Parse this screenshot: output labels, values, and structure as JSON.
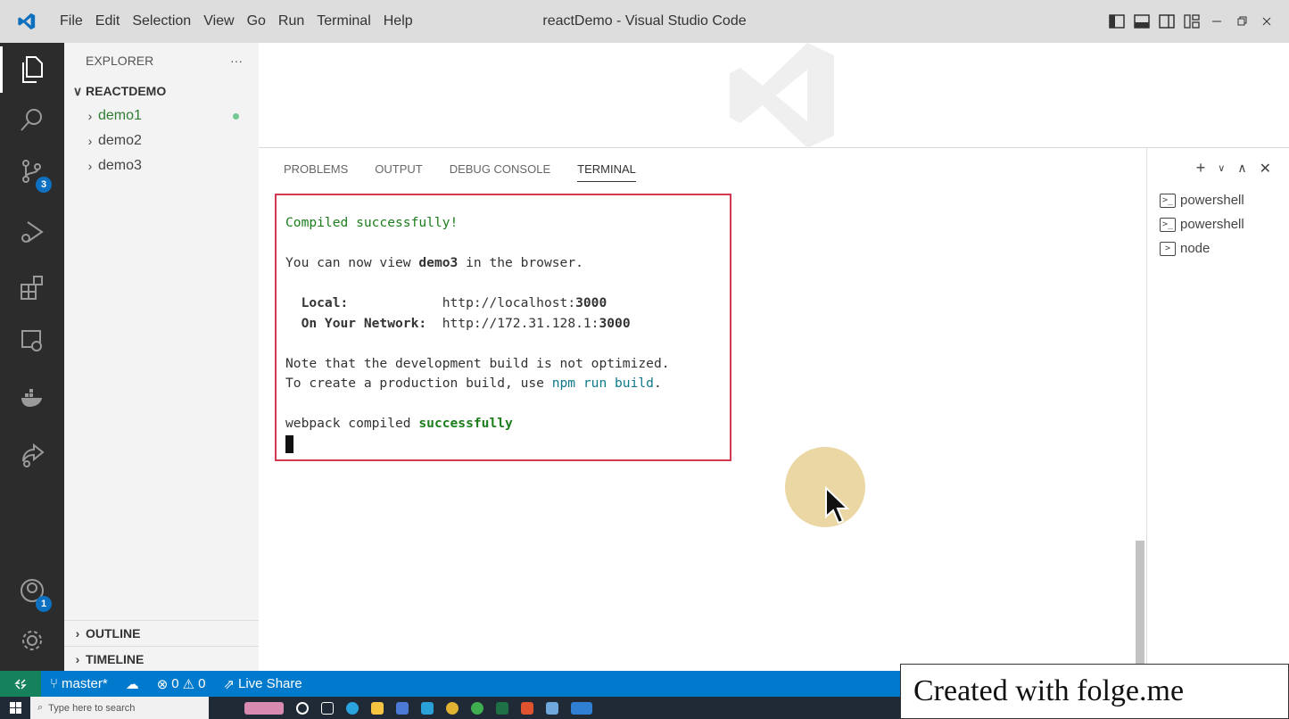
{
  "window": {
    "title": "reactDemo - Visual Studio Code"
  },
  "menu": [
    "File",
    "Edit",
    "Selection",
    "View",
    "Go",
    "Run",
    "Terminal",
    "Help"
  ],
  "activity_bar": {
    "icons": [
      "files-icon",
      "search-icon",
      "source-control-icon",
      "run-debug-icon",
      "extensions-icon",
      "remote-explorer-icon",
      "docker-icon",
      "live-share-icon"
    ],
    "source_control_badge": "3",
    "accounts_badge": "1"
  },
  "explorer": {
    "header": "EXPLORER",
    "more": "···",
    "root": "REACTDEMO",
    "items": [
      "demo1",
      "demo2",
      "demo3"
    ],
    "outline": "OUTLINE",
    "timeline": "TIMELINE"
  },
  "panel": {
    "tabs": [
      "PROBLEMS",
      "OUTPUT",
      "DEBUG CONSOLE",
      "TERMINAL"
    ],
    "active_tab": "TERMINAL",
    "terminals": [
      "powershell",
      "powershell",
      "node"
    ]
  },
  "terminal": {
    "line1": "Compiled successfully!",
    "line2_pre": "You can now view ",
    "line2_app": "demo3",
    "line2_post": " in the browser.",
    "local_label": "  Local:",
    "local_pad": "            ",
    "local_url_pre": "http://localhost:",
    "local_port": "3000",
    "network_label": "  On Your Network:",
    "network_pad": "  ",
    "network_url_pre": "http://172.31.128.1:",
    "network_port": "3000",
    "note1": "Note that the development build is not optimized.",
    "note2_pre": "To create a production build, use ",
    "note2_cmd": "npm run build",
    "note2_post": ".",
    "webpack_pre": "webpack compiled ",
    "webpack_status": "successfully"
  },
  "statusbar": {
    "branch": "master*",
    "errors": "0",
    "warnings": "0",
    "live_share": "Live Share"
  },
  "taskbar": {
    "search_placeholder": "Type here to search"
  },
  "watermark": "Created with folge.me"
}
